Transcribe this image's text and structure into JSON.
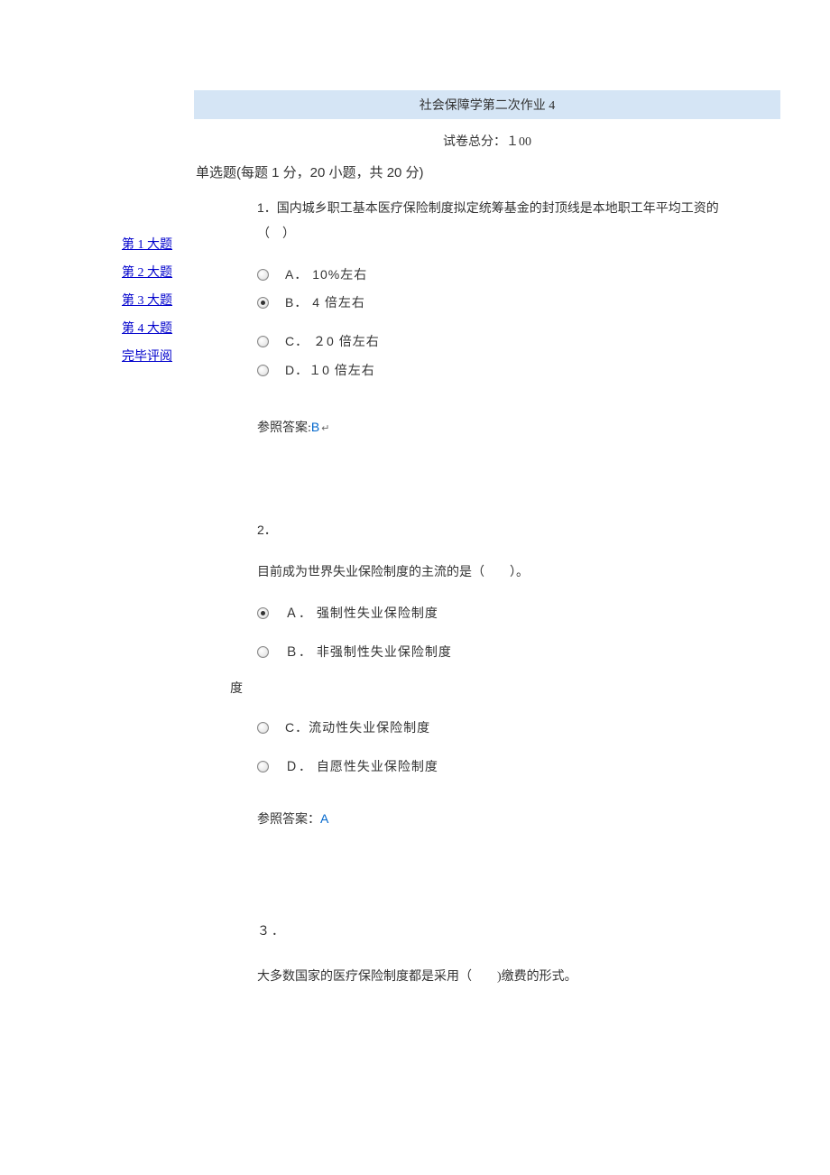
{
  "header": {
    "title": "社会保障学第二次作业  4",
    "score": "试卷总分：１00"
  },
  "sidebar": {
    "items": [
      {
        "label": "第 1 大题"
      },
      {
        "label": "第 2 大题"
      },
      {
        "label": "第 3 大题"
      },
      {
        "label": "第 4 大题"
      },
      {
        "label": "完毕评阅"
      }
    ]
  },
  "section": {
    "title": "单选题(每题 1 分，20 小题，共 20 分)"
  },
  "questions": [
    {
      "num": "1．",
      "text": "国内城乡职工基本医疗保险制度拟定统筹基金的封顶线是本地职工年平均工资的（　）",
      "options": [
        {
          "prefix": "A．",
          "text": "10%左右",
          "selected": false
        },
        {
          "prefix": "B．",
          "text": " 4 倍左右",
          "selected": true
        },
        {
          "prefix": "C．",
          "text": "２0 倍左右",
          "selected": false
        },
        {
          "prefix": "D．",
          "text": "１0 倍左右",
          "selected": false
        }
      ],
      "answer_label": "参照答案:",
      "answer_value": "B",
      "answer_mark": "↵"
    },
    {
      "num": "2．",
      "text": "目前成为世界失业保险制度的主流的是（　　）。",
      "options": [
        {
          "prefix": "Ａ．",
          "text": "强制性失业保险制度",
          "selected": true
        },
        {
          "prefix": "Ｂ．",
          "text": "非强制性失业保险制度",
          "selected": false
        },
        {
          "prefix": "C．",
          "text": "流动性失业保险制度",
          "selected": false
        },
        {
          "prefix": "Ｄ．",
          "text": " 自愿性失业保险制度",
          "selected": false
        }
      ],
      "answer_label": "参照答案：",
      "answer_value": "A",
      "answer_mark": ""
    },
    {
      "num": "３．",
      "text": "大多数国家的医疗保险制度都是采用（　　)缴费的形式。",
      "options": [],
      "answer_label": "",
      "answer_value": "",
      "answer_mark": ""
    }
  ]
}
